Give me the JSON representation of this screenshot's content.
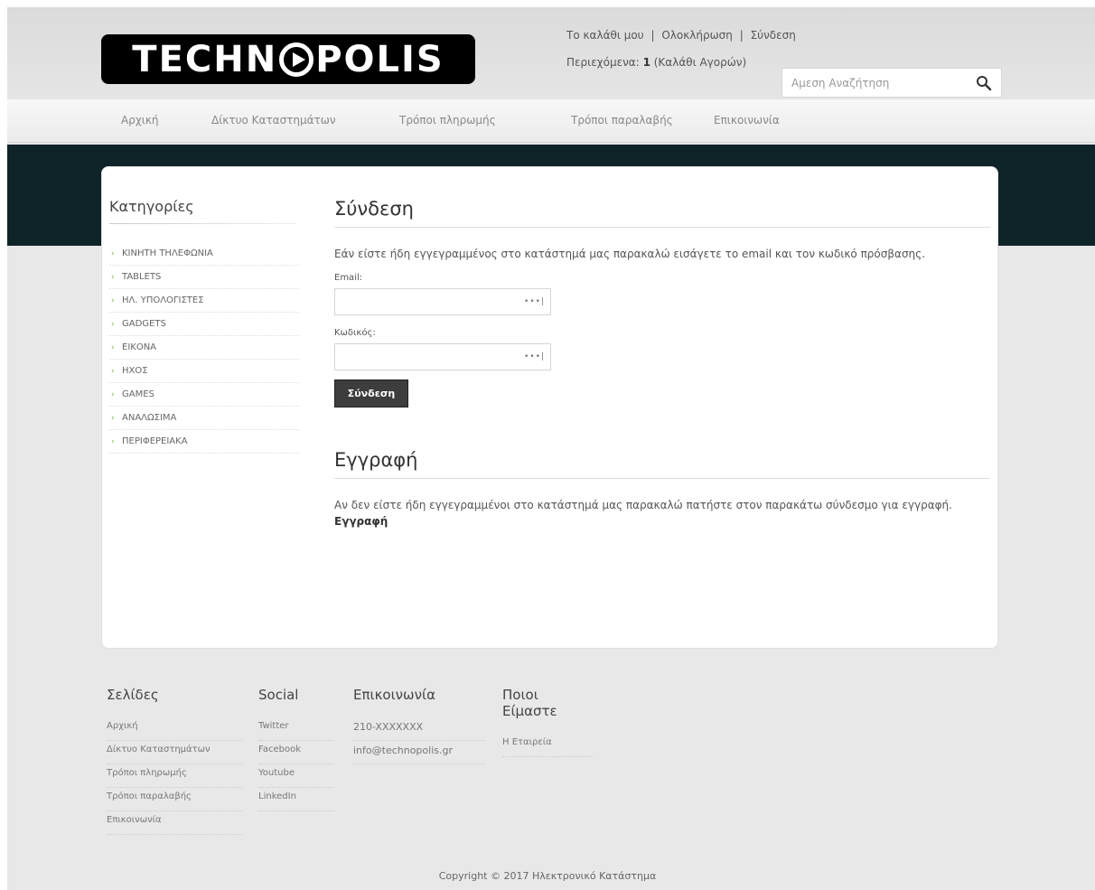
{
  "brand": {
    "logo_left": "TECHN",
    "logo_right": "POLIS"
  },
  "toplinks": {
    "cart": "Το καλάθι μου",
    "checkout": "Ολοκλήρωση",
    "login": "Σύνδεση",
    "sep": "|"
  },
  "cart_summary": {
    "label": "Περιεχόμενα:",
    "count": "1",
    "suffix": "(Καλάθι Αγορών)"
  },
  "search": {
    "placeholder": "Αμεση Αναζήτηση"
  },
  "nav": [
    "Αρχική",
    "Δίκτυο Καταστημάτων",
    "Τρόποι πληρωμής",
    "Τρόποι παραλαβής",
    "Επικοινωνία"
  ],
  "sidebar": {
    "title": "Κατηγορίες",
    "items": [
      "ΚΙΝΗΤΗ ΤΗΛΕΦΩΝΙΑ",
      "TABLETS",
      "ΗΛ. ΥΠΟΛΟΓΙΣΤΕΣ",
      "GADGETS",
      "ΕΙΚΟΝΑ",
      "ΗΧΟΣ",
      "GAMES",
      "ΑΝΑΛΩΣΙΜΑ",
      "ΠΕΡΙΦΕΡΕΙΑΚΑ"
    ]
  },
  "login_section": {
    "title": "Σύνδεση",
    "intro": "Εάν είστε ήδη εγγεγραμμένος στο κατάστημά μας παρακαλώ εισάγετε το email και τον κωδικό πρόσβασης.",
    "email_label": "Email:",
    "password_label": "Κωδικός:",
    "field_icon": "•••|",
    "submit": "Σύνδεση"
  },
  "register_section": {
    "title": "Εγγραφή",
    "intro": "Αν δεν είστε ήδη εγγεγραμμένοι στο κατάστημά μας παρακαλώ πατήστε στον παρακάτω σύνδεσμο για εγγραφή.",
    "link": "Εγγραφή"
  },
  "footer": {
    "pages": {
      "title": "Σελίδες",
      "items": [
        "Αρχική",
        "Δίκτυο Καταστημάτων",
        "Τρόποι πληρωμής",
        "Τρόποι παραλαβής",
        "Επικοινωνία"
      ]
    },
    "social": {
      "title": "Social",
      "items": [
        "Twitter",
        "Facebook",
        "Youtube",
        "LinkedIn"
      ]
    },
    "contact": {
      "title": "Επικοινωνία",
      "items": [
        "210-XXXXXXX",
        "info@technopolis.gr"
      ]
    },
    "about": {
      "title": "Ποιοι Είμαστε",
      "items": [
        "Η Εταιρεία"
      ]
    }
  },
  "copyright": "Copyright © 2017 Ηλεκτρονικό Κατάστημα",
  "colors": {
    "dark_band": "#0f2428",
    "bullet": "#79b938",
    "button": "#3d3d3d"
  }
}
